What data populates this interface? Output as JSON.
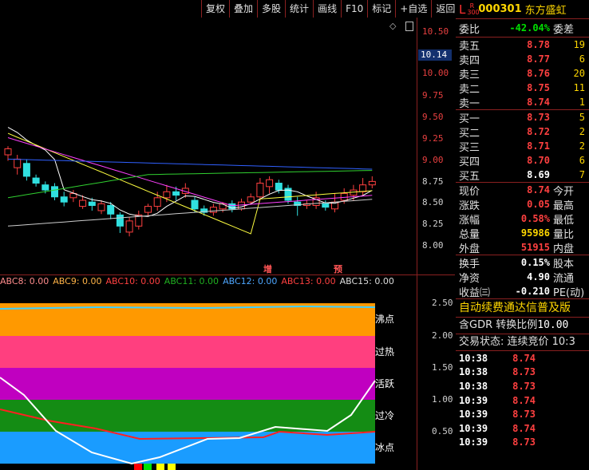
{
  "toolbar": {
    "buttons": [
      "复权",
      "叠加",
      "多股",
      "统计",
      "画线",
      "F10",
      "标记",
      "+自选",
      "返回"
    ]
  },
  "main_chart": {
    "current_price_tag": "10.14",
    "price_ticks": [
      "10.50",
      "10.00",
      "9.75",
      "9.50",
      "9.25",
      "9.00",
      "8.75",
      "8.50",
      "8.25",
      "8.00"
    ],
    "markers": [
      "增",
      "预"
    ]
  },
  "sub_chart": {
    "legend": [
      {
        "text": "ABC8: 0.00",
        "color": "#ff8c8c"
      },
      {
        "text": "ABC9: 0.00",
        "color": "#ffb347"
      },
      {
        "text": "ABC10: 0.00",
        "color": "#ff4040"
      },
      {
        "text": "ABC11: 0.00",
        "color": "#20b020"
      },
      {
        "text": "ABC12: 0.00",
        "color": "#4da6ff"
      },
      {
        "text": "ABC13: 0.00",
        "color": "#ff4040"
      },
      {
        "text": "ABC15: 0.00",
        "color": "#dddddd"
      }
    ],
    "zones": [
      "沸点",
      "过热",
      "活跃",
      "过冷",
      "冰点"
    ],
    "ticks": [
      "2.50",
      "2.00",
      "1.50",
      "1.00",
      "0.50"
    ],
    "zone_colors": [
      "#ff9900",
      "#ff3f7f",
      "#c000c0",
      "#148c14",
      "#1a9cff"
    ]
  },
  "quote": {
    "L": "L",
    "R_top": "R",
    "R_bottom": "300",
    "code": "000301",
    "name": "东方盛虹",
    "weibi": {
      "label": "委比",
      "value": "-42.04%",
      "label2": "委差"
    },
    "asks": [
      {
        "label": "卖五",
        "price": "8.78",
        "vol": "19"
      },
      {
        "label": "卖四",
        "price": "8.77",
        "vol": "6"
      },
      {
        "label": "卖三",
        "price": "8.76",
        "vol": "20"
      },
      {
        "label": "卖二",
        "price": "8.75",
        "vol": "11"
      },
      {
        "label": "卖一",
        "price": "8.74",
        "vol": "1"
      }
    ],
    "bids": [
      {
        "label": "买一",
        "price": "8.73",
        "vol": "5"
      },
      {
        "label": "买二",
        "price": "8.72",
        "vol": "2"
      },
      {
        "label": "买三",
        "price": "8.71",
        "vol": "2"
      },
      {
        "label": "买四",
        "price": "8.70",
        "vol": "6"
      },
      {
        "label": "买五",
        "price": "8.69",
        "vol": "7"
      }
    ],
    "stats": [
      {
        "label": "现价",
        "value": "8.74",
        "label2": "今开",
        "color": "red"
      },
      {
        "label": "涨跌",
        "value": "0.05",
        "label2": "最高",
        "color": "red"
      },
      {
        "label": "涨幅",
        "value": "0.58%",
        "label2": "最低",
        "color": "red"
      },
      {
        "label": "总量",
        "value": "95986",
        "label2": "量比",
        "color": "yellow"
      },
      {
        "label": "外盘",
        "value": "51915",
        "label2": "内盘",
        "color": "red"
      }
    ],
    "stats2": [
      {
        "label": "换手",
        "value": "0.15%",
        "label2": "股本",
        "color": "white"
      },
      {
        "label": "净资",
        "value": "4.90",
        "label2": "流通",
        "color": "white"
      },
      {
        "label": "收益㈢",
        "value": "-0.210",
        "label2": "PE(动)",
        "color": "white"
      }
    ],
    "banner": "自动续费通达信普及版",
    "gdr_label": "含GDR 转换比例",
    "gdr_value": "10.00",
    "trade_status": "交易状态: 连续竞价 10:3",
    "trades": [
      {
        "time": "10:38",
        "price": "8.74"
      },
      {
        "time": "10:38",
        "price": "8.73"
      },
      {
        "time": "10:38",
        "price": "8.73"
      },
      {
        "time": "10:39",
        "price": "8.74"
      },
      {
        "time": "10:39",
        "price": "8.73"
      },
      {
        "time": "10:39",
        "price": "8.74"
      },
      {
        "time": "10:39",
        "price": "8.73"
      }
    ]
  }
}
